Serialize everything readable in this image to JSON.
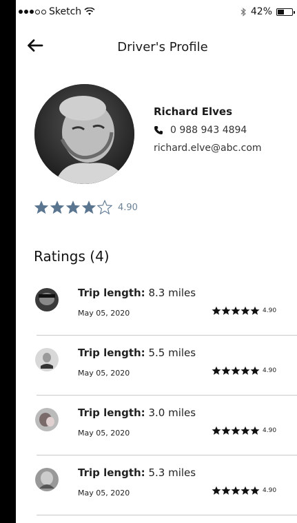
{
  "status_bar": {
    "carrier": "Sketch",
    "battery_percent": "42%",
    "signal_bars_filled": 3,
    "signal_bars_total": 5
  },
  "nav": {
    "title": "Driver's Profile",
    "back_icon": "arrow-left-icon"
  },
  "driver": {
    "name": "Richard Elves",
    "phone": "0 988 943 4894",
    "email": "richard.elve@abc.com",
    "rating_value": "4.90",
    "stars_filled": 4,
    "stars_total": 5,
    "star_color": "#5a7590"
  },
  "ratings": {
    "title": "Ratings (4)",
    "items": [
      {
        "trip_label": "Trip length:",
        "trip_value": "8.3 miles",
        "date": "May 05, 2020",
        "rating": "4.90",
        "stars": 5
      },
      {
        "trip_label": "Trip length:",
        "trip_value": "5.5 miles",
        "date": "May 05, 2020",
        "rating": "4.90",
        "stars": 5
      },
      {
        "trip_label": "Trip length:",
        "trip_value": "3.0 miles",
        "date": "May 05, 2020",
        "rating": "4.90",
        "stars": 5
      },
      {
        "trip_label": "Trip length:",
        "trip_value": "5.3 miles",
        "date": "May 05, 2020",
        "rating": "4.90",
        "stars": 5
      }
    ]
  }
}
